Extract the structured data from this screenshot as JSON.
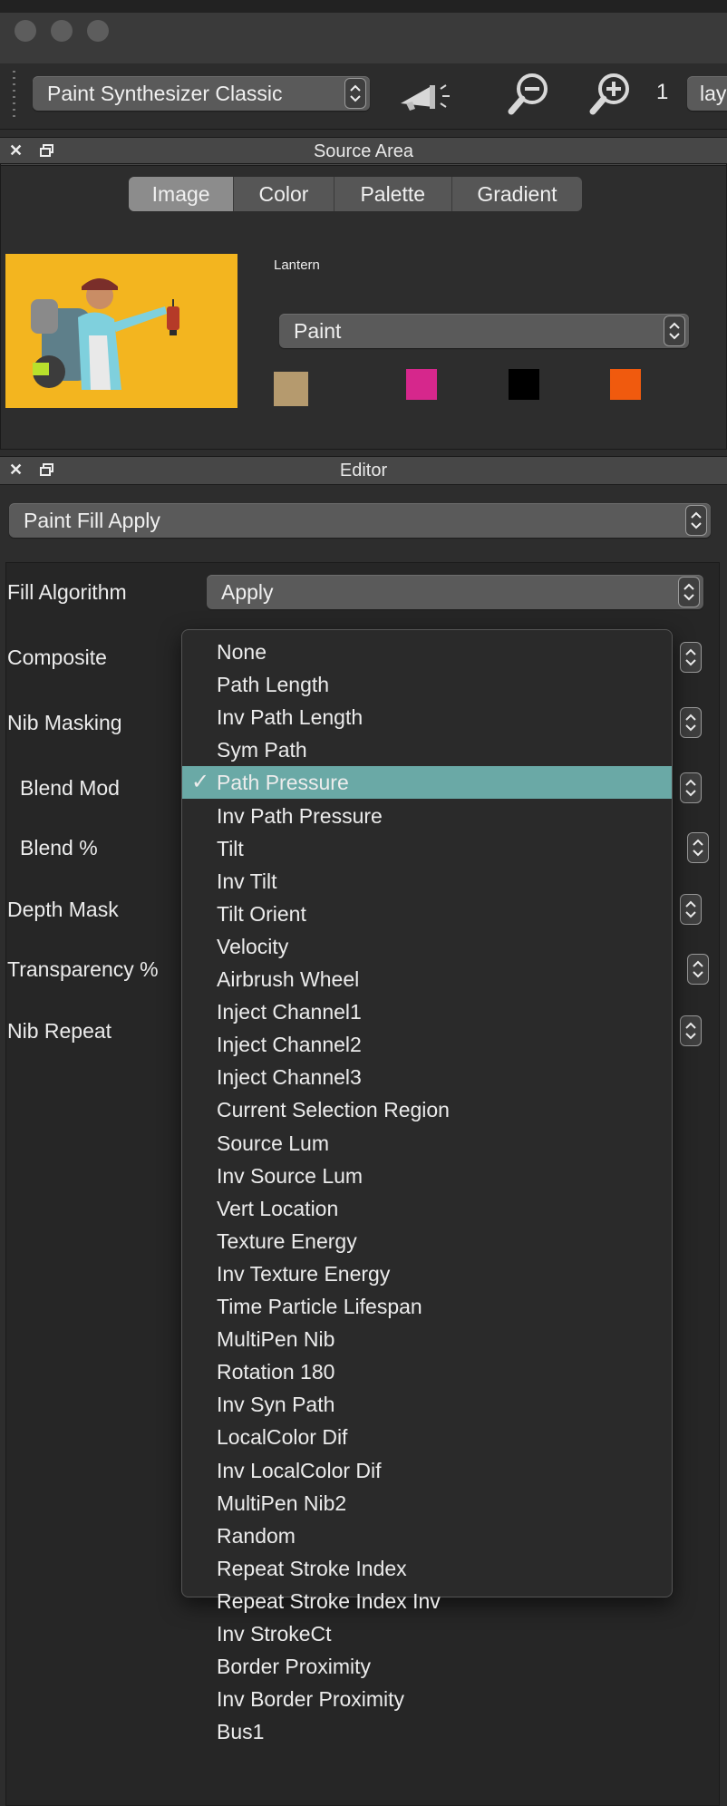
{
  "toolbar": {
    "preset_select": "Paint Synthesizer Classic",
    "zoom_value": "1",
    "layer_select_partial": "lay"
  },
  "source_area": {
    "title": "Source Area",
    "tabs": [
      "Image",
      "Color",
      "Palette",
      "Gradient"
    ],
    "active_tab": "Image",
    "image_name": "Lantern",
    "paint_select": "Paint",
    "swatches": [
      "#b59a6e",
      "#d6278c",
      "#000000",
      "#f05a0e"
    ]
  },
  "editor": {
    "title": "Editor",
    "preset_select": "Paint Fill Apply",
    "rows": [
      {
        "label": "Fill Algorithm",
        "value": "Apply"
      },
      {
        "label": "Composite"
      },
      {
        "label": "Nib Masking"
      },
      {
        "label": "Blend Mod"
      },
      {
        "label": "Blend %"
      },
      {
        "label": "Depth Mask"
      },
      {
        "label": "Transparency %"
      },
      {
        "label": "Nib Repeat"
      }
    ]
  },
  "menu": {
    "selected": "Path Pressure",
    "items": [
      "None",
      "Path Length",
      "Inv Path Length",
      "Sym Path",
      "Path Pressure",
      "Inv Path Pressure",
      "Tilt",
      "Inv Tilt",
      "Tilt Orient",
      "Velocity",
      "Airbrush Wheel",
      "Inject Channel1",
      "Inject Channel2",
      "Inject Channel3",
      "Current Selection Region",
      "Source Lum",
      "Inv Source Lum",
      "Vert Location",
      "Texture Energy",
      "Inv Texture Energy",
      "Time Particle Lifespan",
      "MultiPen Nib",
      "Rotation 180",
      "Inv Syn Path",
      "LocalColor Dif",
      "Inv LocalColor Dif",
      "MultiPen Nib2",
      "Random",
      "Repeat Stroke Index",
      "Repeat Stroke Index Inv",
      "Inv StrokeCt",
      "Border Proximity",
      "Inv Border Proximity",
      "Bus1"
    ]
  },
  "icons": {
    "close": "close-icon",
    "float": "float-window-icon",
    "megaphone": "megaphone-icon",
    "zoom_out": "zoom-out-icon",
    "zoom_in": "zoom-in-icon",
    "checkmark": "✓"
  }
}
